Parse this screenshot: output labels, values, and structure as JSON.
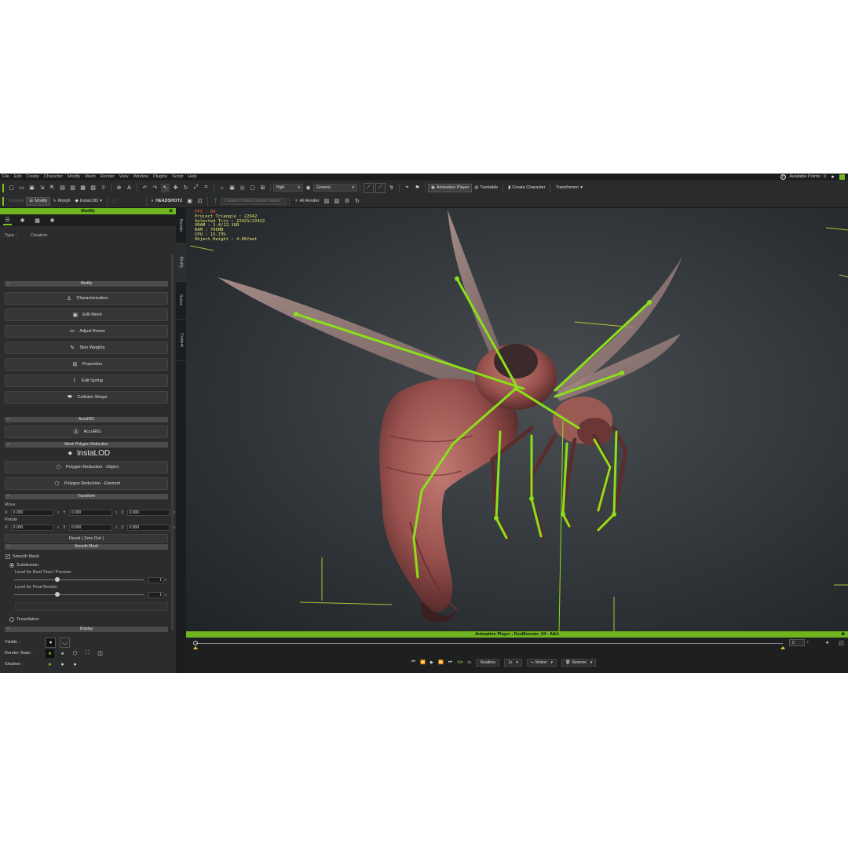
{
  "menu": [
    "File",
    "Edit",
    "Create",
    "Character",
    "Modify",
    "Mesh",
    "Render",
    "View",
    "Window",
    "Plugins",
    "Script",
    "Help"
  ],
  "points_label": "Available Points : 0",
  "toolbar1": {
    "quality": "High",
    "mode": "General",
    "animation_player": "Animation Player",
    "turntable": "Turntable",
    "create_character": "Create Character",
    "transformer": "Transformer"
  },
  "toolbar2": {
    "content": "Content",
    "modify": "Modify",
    "morph": "Morph",
    "instalod": "InstaLOD",
    "headshot": "HEADSHOT2",
    "search_placeholder": "Search Online Content Search",
    "ai_render": "AI Render"
  },
  "panel": {
    "title": "Modify",
    "type_label": "Type :",
    "type_value": "Creature",
    "sec_modify": "Modify",
    "buttons": [
      "Characterization",
      "Edit Mesh",
      "Adjust Bones",
      "Skin Weights",
      "Proportion",
      "Edit Spring",
      "Collision Shape"
    ],
    "sec_accurig": "AccuRIG",
    "accurig_btn": "AccuRIG",
    "sec_mesh_polygon": "Mesh Polygon Reduction",
    "instalod_logo": "InstaLOD",
    "poly_object": "Polygon Reduction - Object",
    "poly_element": "Polygon Reduction - Element",
    "sec_transform": "Transform",
    "move_label": "Move",
    "rotate_label": "Rotate",
    "x": "X",
    "y": "Y",
    "z": "Z",
    "move_x": "0.000",
    "move_y": "0.000",
    "move_z": "0.000",
    "rot_x": "0.000",
    "rot_y": "0.000",
    "rot_z": "0.000",
    "reset_btn": "Reset ( Zero Out )",
    "sec_smooth": "Smooth Mesh",
    "smooth_mesh": "Smooth Mesh",
    "subdivision": "Subdivision",
    "level_realtime": "Level for Real Time / Preview",
    "level_realtime_value": "1",
    "level_final": "Level for Final Render",
    "level_final_value": "1",
    "tessellation": "Tessellation",
    "sec_display": "Display",
    "visible": "Visible :",
    "render_state": "Render State :",
    "shadow": "Shadow :"
  },
  "side_tabs": [
    "Render",
    "Modify",
    "Scene",
    "Content"
  ],
  "stats": {
    "fps": "FPS : 84",
    "project_triangle": "Project Triangle : 22942",
    "selected_tris": "Selected Tris : 22421/22422",
    "vram": "VRAM : 1.4/12.1GB",
    "ram": "RAM : 796MB",
    "cpu": "CPU : 15.73%",
    "object_height": "Object Height : 4.66feet"
  },
  "anim": {
    "title": "Animation Player : DevMonster_04 - Atk1",
    "frame": "0",
    "realtime": "Realtime",
    "speed": "1x",
    "motion": "Motion",
    "remove": "Remove"
  },
  "colors": {
    "accent": "#6fb51f",
    "bones": "#8be01a",
    "creature": "#a85a56"
  }
}
